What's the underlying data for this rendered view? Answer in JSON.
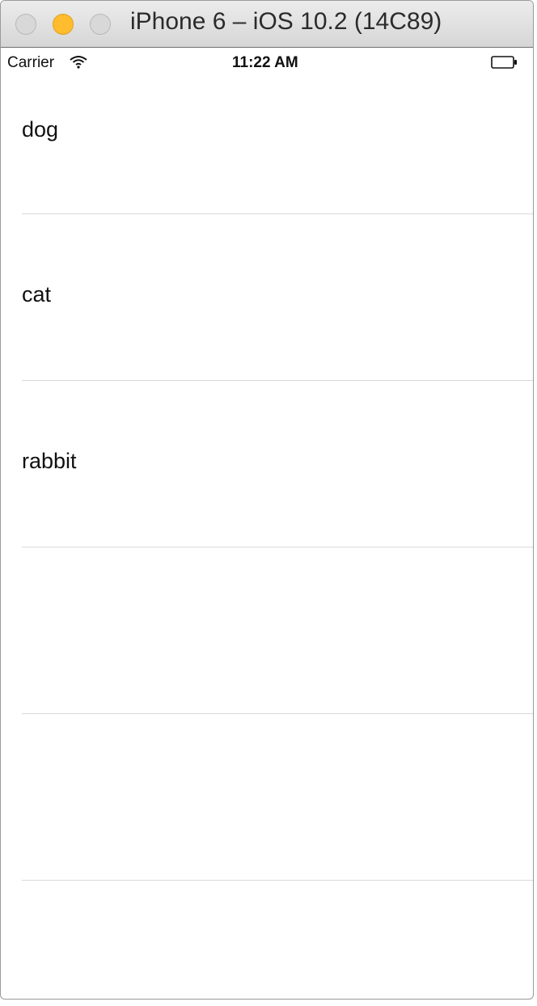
{
  "window": {
    "title": "iPhone 6 – iOS 10.2 (14C89)"
  },
  "status_bar": {
    "carrier": "Carrier",
    "time": "11:22 AM",
    "wifi_icon": "wifi-icon",
    "battery_icon": "battery-icon"
  },
  "table": {
    "rows": [
      {
        "label": "dog"
      },
      {
        "label": "cat"
      },
      {
        "label": "rabbit"
      },
      {
        "label": ""
      },
      {
        "label": ""
      }
    ]
  },
  "colors": {
    "minimize": "#febc2e",
    "separator": "#d9d9d9"
  }
}
